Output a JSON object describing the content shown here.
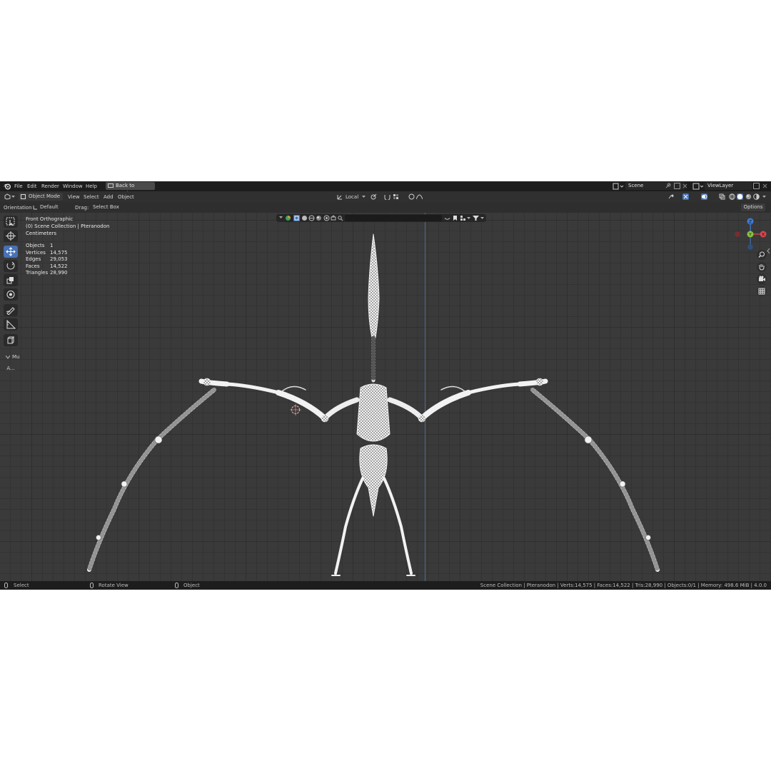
{
  "topbar": {
    "menu": [
      "File",
      "Edit",
      "Render",
      "Window",
      "Help"
    ],
    "back_button": "Back to Previous",
    "scene": "Scene",
    "view_layer": "ViewLayer"
  },
  "header": {
    "mode": "Object Mode",
    "menu": [
      "View",
      "Select",
      "Add",
      "Object"
    ],
    "transform_space": "Local"
  },
  "tool_settings": {
    "orientation_label": "Orientation:",
    "orientation_value": "Default",
    "drag_label": "Drag:",
    "drag_value": "Select Box",
    "options_label": "Options"
  },
  "overlay": {
    "view_name": "Front Orthographic",
    "collection": "(0) Scene Collection | Pteranodon",
    "units": "Centimeters",
    "stats": [
      {
        "label": "Objects",
        "value": "1"
      },
      {
        "label": "Vertices",
        "value": "14,575"
      },
      {
        "label": "Edges",
        "value": "29,053"
      },
      {
        "label": "Faces",
        "value": "14,522"
      },
      {
        "label": "Triangles",
        "value": "28,990"
      }
    ]
  },
  "left_panel": {
    "section": "Mu",
    "item": "A..."
  },
  "gizmo": {
    "axes": [
      "Z",
      "Y",
      "X"
    ]
  },
  "statusbar": {
    "select": "Select",
    "rotate": "Rotate View",
    "object": "Object",
    "info": "Scene Collection | Pteranodon | Verts:14,575 | Faces:14,522 | Tris:28,990 | Objects:0/1 | Memory: 498.6 MiB | 4.0.0"
  },
  "colors": {
    "accent": "#4772b3",
    "axis_x": "#d9464f",
    "axis_y": "#8bc33d",
    "axis_z": "#3f7cd6"
  }
}
